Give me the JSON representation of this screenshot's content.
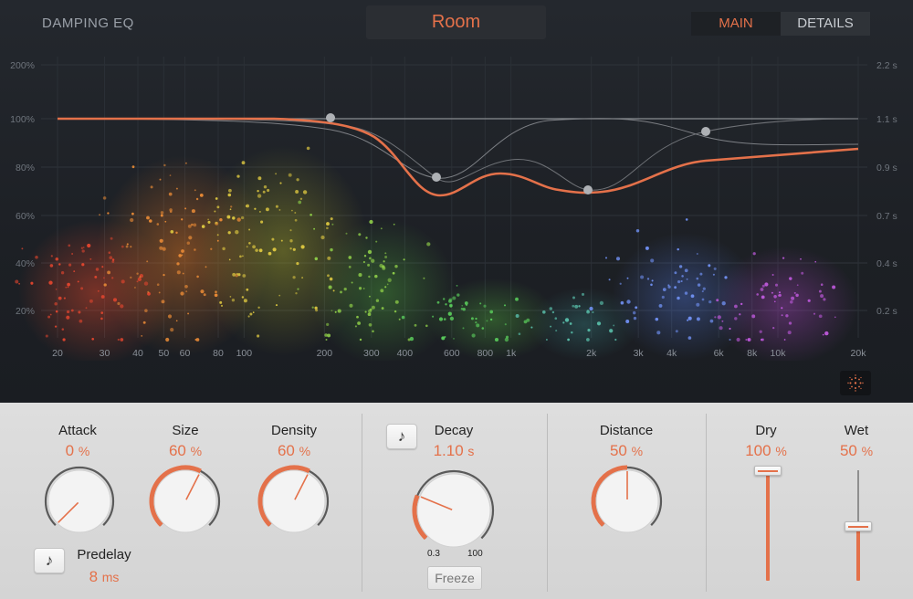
{
  "header": {
    "eq_title": "DAMPING EQ",
    "preset": "Room",
    "tabs": [
      {
        "label": "MAIN",
        "active": true
      },
      {
        "label": "DETAILS",
        "active": false
      }
    ]
  },
  "eq_graph": {
    "left_axis": [
      "200%",
      "100%",
      "80%",
      "60%",
      "40%",
      "20%"
    ],
    "right_axis": [
      "2.2 s",
      "1.1 s",
      "0.9 s",
      "0.7 s",
      "0.4 s",
      "0.2 s"
    ],
    "freq_labels": [
      "20",
      "30",
      "40",
      "50",
      "60",
      "80",
      "100",
      "200",
      "300",
      "400",
      "600",
      "800",
      "1k",
      "2k",
      "3k",
      "4k",
      "6k",
      "8k",
      "10k",
      "20k"
    ],
    "curve_color": "#e4714a",
    "bands": [
      {
        "freq_hz": 200,
        "level_pct": 100
      },
      {
        "freq_hz": 500,
        "level_pct": 86
      },
      {
        "freq_hz": 2000,
        "level_pct": 70
      },
      {
        "freq_hz": 5500,
        "level_pct": 94
      }
    ]
  },
  "controls": {
    "attack": {
      "label": "Attack",
      "value": "0",
      "unit": "%",
      "level": 0.0
    },
    "size": {
      "label": "Size",
      "value": "60",
      "unit": "%",
      "level": 0.6
    },
    "density": {
      "label": "Density",
      "value": "60",
      "unit": "%",
      "level": 0.6
    },
    "predelay": {
      "label": "Predelay",
      "value": "8",
      "unit": "ms"
    },
    "decay": {
      "label": "Decay",
      "value": "1.10",
      "unit": "s",
      "level": 0.25,
      "min_label": "0.3",
      "max_label": "100"
    },
    "freeze": {
      "label": "Freeze"
    },
    "distance": {
      "label": "Distance",
      "value": "50",
      "unit": "%",
      "level": 0.5
    },
    "dry": {
      "label": "Dry",
      "value": "100",
      "unit": "%",
      "level": 1.0
    },
    "wet": {
      "label": "Wet",
      "value": "50",
      "unit": "%",
      "level": 0.5
    }
  },
  "icons": {
    "note": "♪",
    "particles": "particles-icon"
  }
}
